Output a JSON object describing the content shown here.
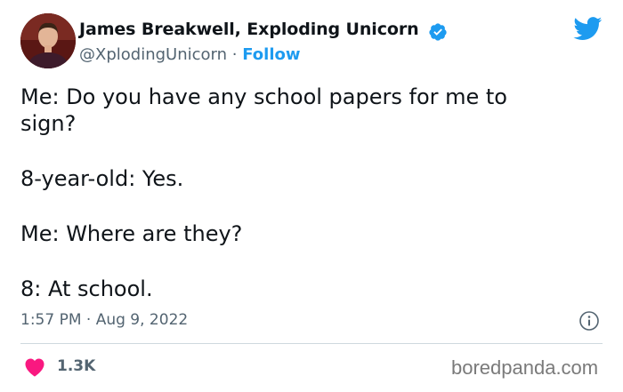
{
  "author": {
    "name": "James Breakwell, Exploding Unicorn",
    "handle": "@XplodingUnicorn",
    "separator": "·",
    "follow_label": "Follow"
  },
  "tweet": {
    "lines": [
      "Me: Do you have any school papers for me to",
      "sign?",
      "",
      "8-year-old: Yes.",
      "",
      "Me: Where are they?",
      "",
      "8: At school."
    ],
    "timestamp": "1:57 PM · Aug 9, 2022"
  },
  "engagement": {
    "like_count": "1.3K"
  },
  "watermark": "boredpanda.com",
  "colors": {
    "accent": "#1d9bf0",
    "like": "#f91880",
    "text": "#0f1419",
    "secondary": "#536471",
    "divider": "#cfd9de"
  },
  "icons": {
    "avatar": "profile-photo",
    "verified": "verified-badge-icon",
    "logo": "twitter-bird-icon",
    "info": "info-icon",
    "like": "heart-icon"
  }
}
